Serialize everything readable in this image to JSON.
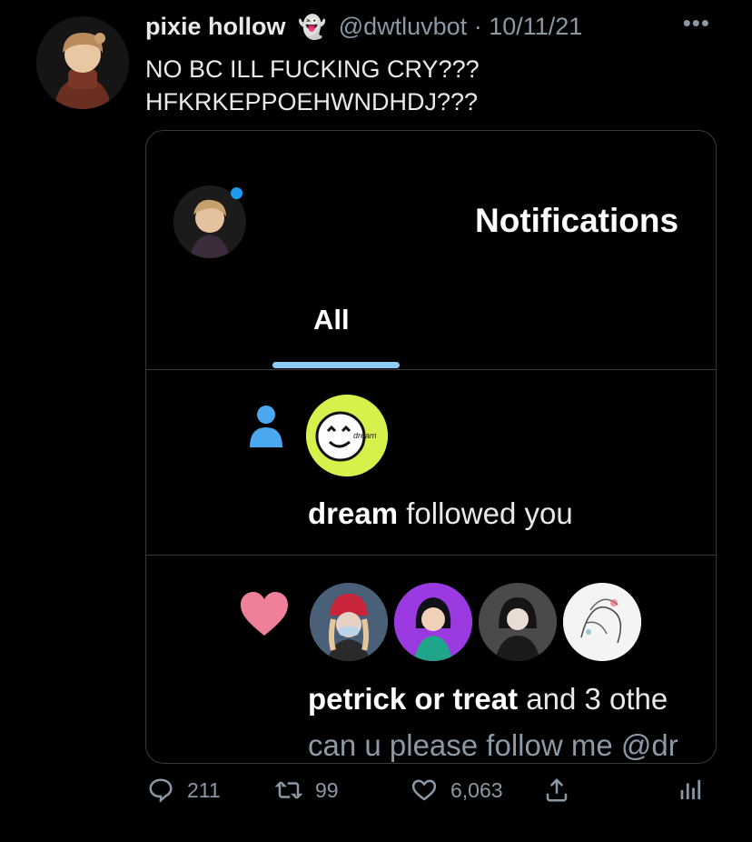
{
  "tweet": {
    "display_name": "pixie hollow",
    "emoji": "👻",
    "handle": "@dwtluvbot",
    "separator": "·",
    "date": "10/11/21",
    "more_icon": "more-icon",
    "text_line1": "NO BC ILL FUCKING CRY???",
    "text_line2": "HFKRKEPPOEHWNDHDJ???"
  },
  "screenshot": {
    "title": "Notifications",
    "tab_all": "All",
    "follow_row": {
      "name": "dream",
      "action": " followed you",
      "avatar_label": "dream"
    },
    "like_row": {
      "name": "petrick or treat",
      "rest": " and 3 othe",
      "sub": "can u please follow me @dr"
    }
  },
  "actions": {
    "replies": "211",
    "retweets": "99",
    "likes": "6,063"
  },
  "colors": {
    "accent": "#1d9bf0",
    "tab_underline": "#8ecdf8",
    "heart": "#f07f9a",
    "muted": "#8b98a5"
  }
}
